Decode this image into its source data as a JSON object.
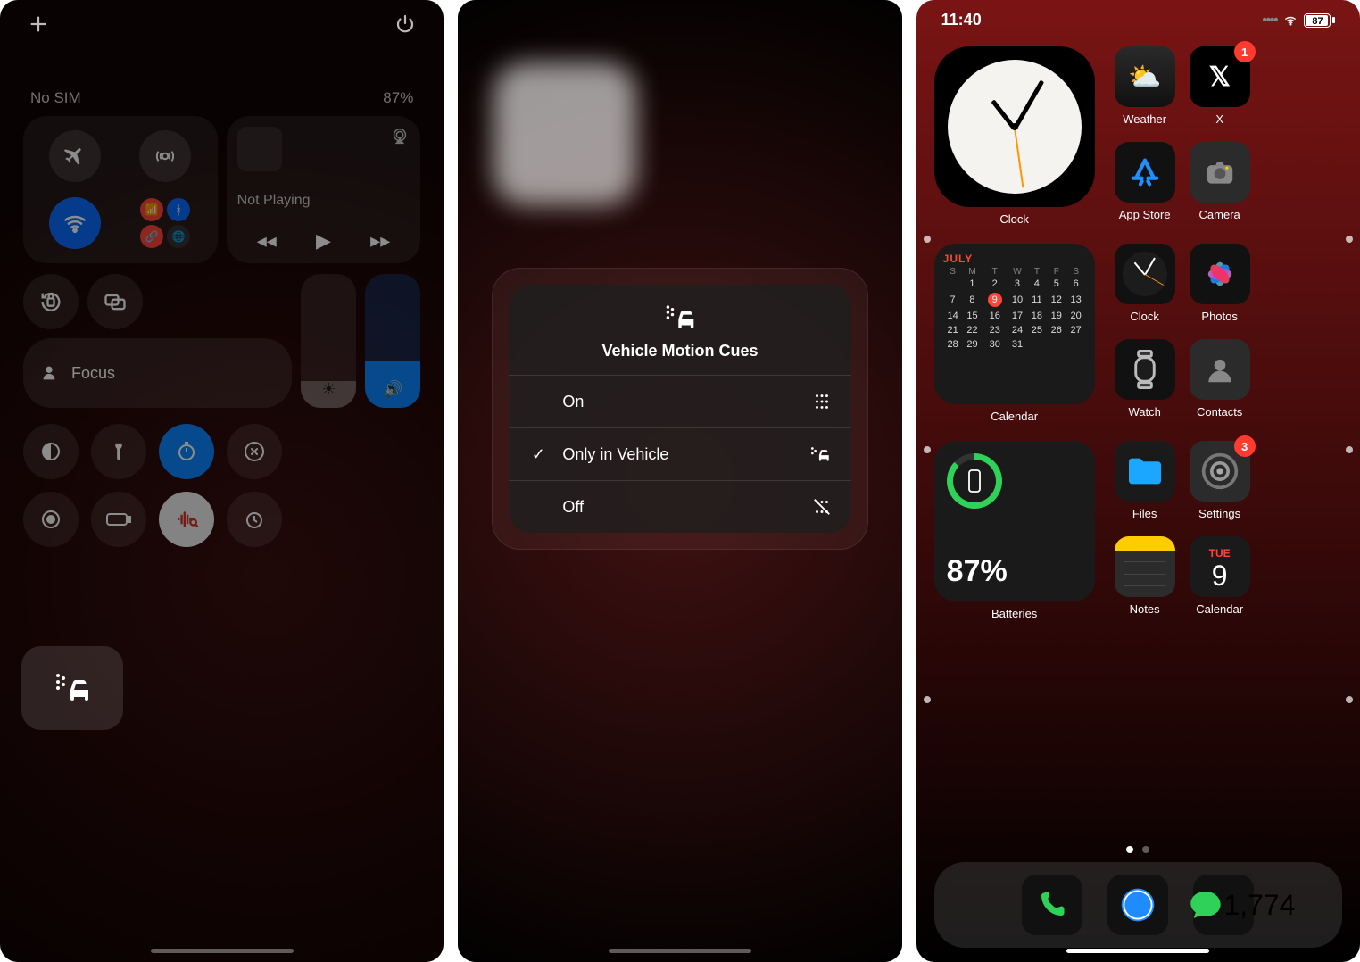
{
  "panel1": {
    "status": {
      "carrier": "No SIM",
      "battery_text": "87%"
    },
    "media": {
      "now_playing": "Not Playing"
    },
    "focus_label": "Focus",
    "motion_tile_icon": "vehicle-motion-cues-icon"
  },
  "panel2": {
    "sheet": {
      "title": "Vehicle Motion Cues",
      "options": [
        {
          "label": "On",
          "selected": false,
          "icon": "cues-on-icon"
        },
        {
          "label": "Only in Vehicle",
          "selected": true,
          "icon": "cues-vehicle-icon"
        },
        {
          "label": "Off",
          "selected": false,
          "icon": "cues-off-icon"
        }
      ]
    }
  },
  "panel3": {
    "status": {
      "time": "11:40",
      "battery_pct": "87",
      "battery_fill_pct": 87
    },
    "apps_row1": [
      {
        "name": "Weather",
        "icon": "weather-icon"
      },
      {
        "name": "X",
        "icon": "x-icon",
        "badge": "1"
      }
    ],
    "apps_row2": [
      {
        "name": "App Store",
        "icon": "appstore-icon"
      },
      {
        "name": "Camera",
        "icon": "camera-icon"
      }
    ],
    "apps_row3": [
      {
        "name": "Clock",
        "icon": "clock-icon"
      },
      {
        "name": "Photos",
        "icon": "photos-icon"
      }
    ],
    "apps_row4": [
      {
        "name": "Watch",
        "icon": "watch-icon"
      },
      {
        "name": "Contacts",
        "icon": "contacts-icon"
      }
    ],
    "apps_row5": [
      {
        "name": "Files",
        "icon": "files-icon"
      },
      {
        "name": "Settings",
        "icon": "settings-icon",
        "badge": "3"
      }
    ],
    "apps_row6": [
      {
        "name": "Notes",
        "icon": "notes-icon"
      },
      {
        "name": "Calendar",
        "icon": "calendar-app-icon",
        "top": "TUE",
        "num": "9"
      }
    ],
    "clock_widget_label": "Clock",
    "calendar_widget": {
      "label": "Calendar",
      "month": "JULY",
      "dow": [
        "S",
        "M",
        "T",
        "W",
        "T",
        "F",
        "S"
      ],
      "weeks": [
        [
          "",
          "1",
          "2",
          "3",
          "4",
          "5",
          "6"
        ],
        [
          "7",
          "8",
          "9",
          "10",
          "11",
          "12",
          "13"
        ],
        [
          "14",
          "15",
          "16",
          "17",
          "18",
          "19",
          "20"
        ],
        [
          "21",
          "22",
          "23",
          "24",
          "25",
          "26",
          "27"
        ],
        [
          "28",
          "29",
          "30",
          "31",
          "",
          "",
          ""
        ]
      ],
      "today": "9"
    },
    "battery_widget": {
      "label": "Batteries",
      "pct_text": "87%"
    },
    "dock": {
      "apps": [
        {
          "name": "Phone",
          "icon": "phone-icon"
        },
        {
          "name": "Safari",
          "icon": "safari-icon"
        },
        {
          "name": "Messages",
          "icon": "messages-icon",
          "badge": "1,774"
        }
      ]
    }
  }
}
